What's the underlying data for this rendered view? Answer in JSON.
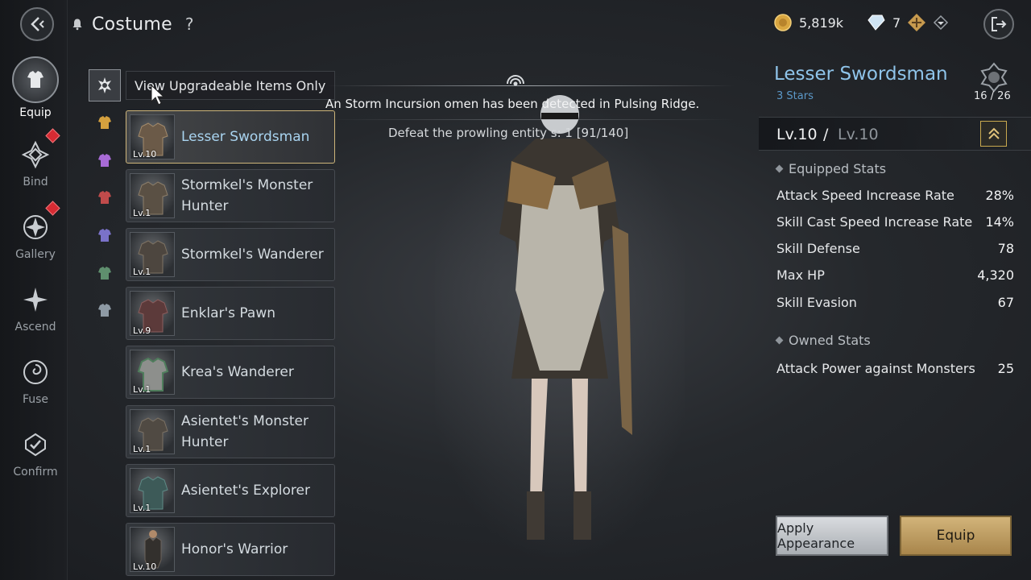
{
  "header": {
    "title": "Costume",
    "help": "?"
  },
  "sidebar": {
    "items": [
      {
        "label": "Equip",
        "active": true
      },
      {
        "label": "Bind",
        "badge": true
      },
      {
        "label": "Gallery",
        "badge": true
      },
      {
        "label": "Ascend"
      },
      {
        "label": "Fuse"
      },
      {
        "label": "Confirm"
      }
    ]
  },
  "currency": {
    "gold": "5,819k",
    "crystal": "7"
  },
  "filter": {
    "label": "View Upgradeable Items Only"
  },
  "color_tabs": [
    "gold",
    "purple",
    "red",
    "violet",
    "green",
    "silver"
  ],
  "costumes": [
    {
      "name": "Lesser Swordsman",
      "level": "Lv.10",
      "selected": true
    },
    {
      "name": "Stormkel's Monster Hunter",
      "level": "Lv.1"
    },
    {
      "name": "Stormkel's Wanderer",
      "level": "Lv.1"
    },
    {
      "name": "Enklar's Pawn",
      "level": "Lv.9"
    },
    {
      "name": "Krea's Wanderer",
      "level": "Lv.1"
    },
    {
      "name": "Asientet's Monster Hunter",
      "level": "Lv.1"
    },
    {
      "name": "Asientet's Explorer",
      "level": "Lv.1"
    },
    {
      "name": "Honor's Warrior",
      "level": "Lv.10"
    }
  ],
  "notice": {
    "line1": "An Storm Incursion omen has been detected in Pulsing Ridge.",
    "line2": "Defeat the prowling entity s: 1 [91/140]"
  },
  "detail": {
    "name": "Lesser Swordsman",
    "stars": "3 Stars",
    "count": "16 / 26",
    "level_current": "Lv.10",
    "slash": "/",
    "level_max": "Lv.10",
    "equipped_header": "Equipped Stats",
    "equipped_stats": [
      {
        "k": "Attack Speed Increase Rate",
        "v": "28%"
      },
      {
        "k": "Skill Cast Speed Increase Rate",
        "v": "14%"
      },
      {
        "k": "Skill Defense",
        "v": "78"
      },
      {
        "k": "Max HP",
        "v": "4,320"
      },
      {
        "k": "Skill Evasion",
        "v": "67"
      }
    ],
    "owned_header": "Owned Stats",
    "owned_stats": [
      {
        "k": "Attack Power against Monsters",
        "v": "25"
      }
    ]
  },
  "buttons": {
    "apply": "Apply Appearance",
    "equip": "Equip"
  },
  "colors": {
    "accent_blue": "#8fc4ea",
    "gold": "#cdb57a",
    "badge_red": "#d62b33"
  }
}
